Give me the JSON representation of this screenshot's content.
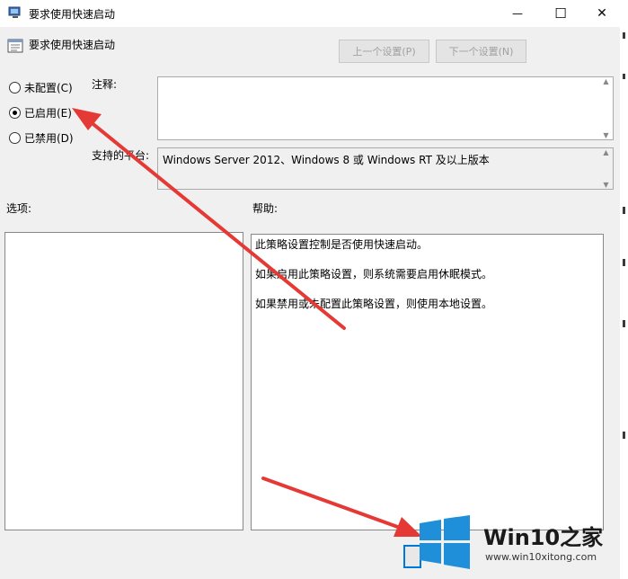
{
  "window": {
    "title": "要求使用快速启动",
    "minimize_glyph": "—",
    "maximize_glyph": "☐",
    "close_glyph": "✕"
  },
  "header": {
    "title": "要求使用快速启动",
    "prev_label": "上一个设置(P)",
    "next_label": "下一个设置(N)"
  },
  "state": {
    "options": [
      {
        "label": "未配置(C)",
        "checked": false
      },
      {
        "label": "已启用(E)",
        "checked": true
      },
      {
        "label": "已禁用(D)",
        "checked": false
      }
    ]
  },
  "comment": {
    "label": "注释:",
    "value": ""
  },
  "platform": {
    "label": "支持的平台:",
    "value": "Windows Server 2012、Windows 8 或 Windows RT 及以上版本"
  },
  "options_panel": {
    "label": "选项:"
  },
  "help_panel": {
    "label": "帮助:",
    "paragraphs": [
      "此策略设置控制是否使用快速启动。",
      "如果启用此策略设置，则系统需要启用休眠模式。",
      "如果禁用或未配置此策略设置，则使用本地设置。"
    ]
  },
  "watermark": {
    "brand": "Win10之家",
    "url": "www.win10xitong.com"
  },
  "colors": {
    "arrow": "#e53935",
    "logo_blue": "#1e8fd8",
    "focus": "#0078d7"
  }
}
